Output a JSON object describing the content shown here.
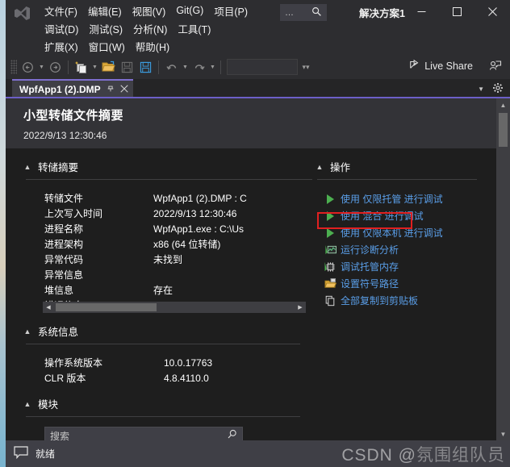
{
  "window": {
    "solution_name": "解决方案1",
    "minimize": "—",
    "maximize": "□",
    "close": "✕"
  },
  "menu": {
    "row1": [
      "文件(F)",
      "编辑(E)",
      "视图(V)",
      "Git(G)",
      "项目(P)"
    ],
    "row2": [
      "调试(D)",
      "测试(S)",
      "分析(N)",
      "工具(T)"
    ],
    "row3": [
      "扩展(X)",
      "窗口(W)",
      "帮助(H)"
    ],
    "search_dots": "…",
    "search_icon": "search-icon"
  },
  "toolbar": {
    "live_share": "Live Share",
    "combo_value": ""
  },
  "tab": {
    "title": "WpfApp1 (2).DMP",
    "pin": "⇱",
    "close": "✕"
  },
  "doc": {
    "title": "小型转储文件摘要",
    "timestamp": "2022/9/13 12:30:46"
  },
  "summary": {
    "header": "转储摘要",
    "rows": [
      {
        "key": "转储文件",
        "value": "WpfApp1 (2).DMP : C"
      },
      {
        "key": "上次写入时间",
        "value": "2022/9/13 12:30:46"
      },
      {
        "key": "进程名称",
        "value": "WpfApp1.exe : C:\\Us"
      },
      {
        "key": "进程架构",
        "value": "x86 (64 位转储)"
      },
      {
        "key": "异常代码",
        "value": "未找到"
      },
      {
        "key": "异常信息",
        "value": ""
      },
      {
        "key": "堆信息",
        "value": "存在"
      },
      {
        "key": "错误信息",
        "value": ""
      }
    ]
  },
  "actions": {
    "header": "操作",
    "items": [
      {
        "label": "使用 仅限托管 进行调试",
        "icon": "play-icon",
        "type": "play"
      },
      {
        "label": "使用 混合 进行调试",
        "icon": "play-icon",
        "type": "play"
      },
      {
        "label": "使用 仅限本机 进行调试",
        "icon": "play-icon",
        "type": "play"
      },
      {
        "label": "运行诊断分析",
        "icon": "diagnostics-icon",
        "type": "glyph"
      },
      {
        "label": "调试托管内存",
        "icon": "memory-chip-icon",
        "type": "glyph"
      },
      {
        "label": "设置符号路径",
        "icon": "folder-open-icon",
        "type": "glyph"
      },
      {
        "label": "全部复制到剪贴板",
        "icon": "copy-icon",
        "type": "glyph"
      }
    ],
    "highlighted_index": 4,
    "highlight_color": "#e02020"
  },
  "system_info": {
    "header": "系统信息",
    "rows": [
      {
        "key": "操作系统版本",
        "value": "10.0.17763"
      },
      {
        "key": "CLR 版本",
        "value": "4.8.4110.0"
      }
    ]
  },
  "modules": {
    "header": "模块",
    "search_placeholder": "搜索"
  },
  "statusbar": {
    "text": "就绪",
    "icon": "feedback-icon",
    "watermark_prefix": "CSDN @",
    "watermark_name": "氛围组队员"
  },
  "colors": {
    "accent_purple": "#6c5fc7",
    "link_blue": "#5a9ee8",
    "play_green": "#4caf50",
    "window_bg": "#2d2d30",
    "doc_bg": "#1e1e1e"
  }
}
